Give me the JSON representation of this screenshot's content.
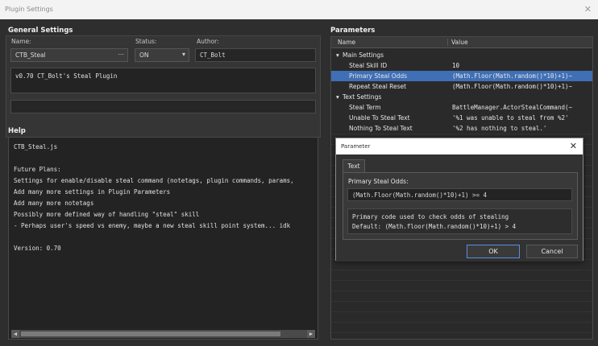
{
  "window": {
    "title": "Plugin Settings",
    "close_glyph": "✕"
  },
  "general": {
    "title": "General Settings",
    "name_label": "Name:",
    "name_value": "CTB_Steal",
    "status_label": "Status:",
    "status_value": "ON",
    "author_label": "Author:",
    "author_value": "CT_Bolt",
    "description": "v0.70 CT_Bolt's Steal Plugin",
    "extra_value": ""
  },
  "help": {
    "title": "Help",
    "lines": [
      "CTB_Steal.js",
      "",
      "Future Plans:",
      "  Settings for enable/disable steal command (notetags, plugin commands, params,",
      "  Add many more settings in Plugin Parameters",
      "  Add many more notetags",
      "  Possibly more defined way of handling \"steal\" skill",
      "   - Perhaps user's speed vs enemy, maybe a new steal skill point system... idk",
      "",
      "Version: 0.70"
    ]
  },
  "parameters": {
    "title": "Parameters",
    "col_name": "Name",
    "col_value": "Value",
    "rows": [
      {
        "name": "Main Settings",
        "value": "",
        "group": true
      },
      {
        "name": "Steal Skill ID",
        "value": "10"
      },
      {
        "name": "Primary Steal Odds",
        "value": "(Math.Floor(Math.random()*10)+1)~",
        "selected": true
      },
      {
        "name": "Repeat Steal Reset",
        "value": "(Math.Floor(Math.random()*10)+1)~"
      },
      {
        "name": "Text Settings",
        "value": "",
        "group": true
      },
      {
        "name": "Steal Term",
        "value": "BattleManager.ActorStealCommand(~"
      },
      {
        "name": "Unable To Steal Text",
        "value": "'%1 was unable to steal from %2'"
      },
      {
        "name": "Nothing To Steal Text",
        "value": "'%2 has nothing to steal.'"
      }
    ]
  },
  "dialog": {
    "title": "Parameter",
    "tab_label": "Text",
    "field_label": "Primary Steal Odds:",
    "field_value": "(Math.Floor(Math.random()*10)+1) >= 4",
    "desc_line1": "Primary code used to check odds of stealing",
    "desc_line2": "Default: (Math.floor(Math.random()*10)+1) > 4",
    "ok_label": "OK",
    "cancel_label": "Cancel"
  },
  "colors": {
    "selection": "#3f6fb5",
    "background": "#2e2e2e",
    "accent": "#5a8ee0"
  }
}
